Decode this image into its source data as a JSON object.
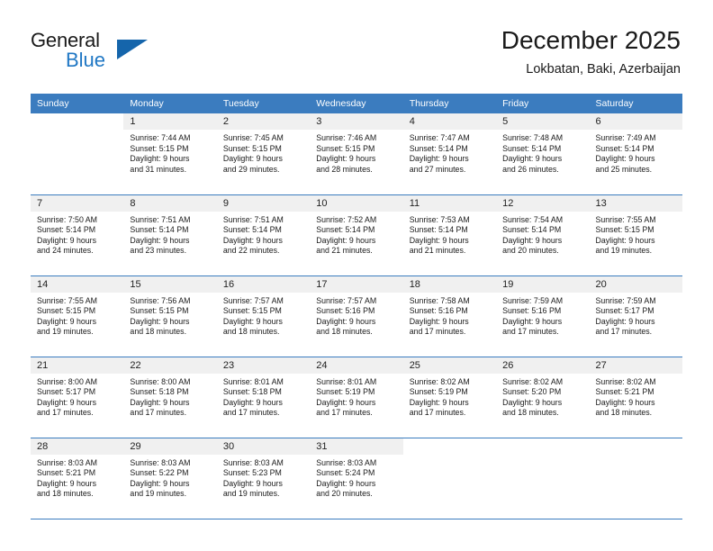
{
  "brand": {
    "line1": "General",
    "line2": "Blue",
    "triangle_color": "#1565ab",
    "blue_color": "#1f77c4"
  },
  "header": {
    "title": "December 2025",
    "subtitle": "Lokbatan, Baki, Azerbaijan"
  },
  "theme": {
    "header_bg": "#3b7cbf",
    "daynum_bg": "#f0f0f0",
    "border": "#3b7cbf"
  },
  "weekday_headers": [
    "Sunday",
    "Monday",
    "Tuesday",
    "Wednesday",
    "Thursday",
    "Friday",
    "Saturday"
  ],
  "weeks": [
    [
      {
        "day": "",
        "lines": []
      },
      {
        "day": "1",
        "lines": [
          "Sunrise: 7:44 AM",
          "Sunset: 5:15 PM",
          "Daylight: 9 hours",
          "and 31 minutes."
        ]
      },
      {
        "day": "2",
        "lines": [
          "Sunrise: 7:45 AM",
          "Sunset: 5:15 PM",
          "Daylight: 9 hours",
          "and 29 minutes."
        ]
      },
      {
        "day": "3",
        "lines": [
          "Sunrise: 7:46 AM",
          "Sunset: 5:15 PM",
          "Daylight: 9 hours",
          "and 28 minutes."
        ]
      },
      {
        "day": "4",
        "lines": [
          "Sunrise: 7:47 AM",
          "Sunset: 5:14 PM",
          "Daylight: 9 hours",
          "and 27 minutes."
        ]
      },
      {
        "day": "5",
        "lines": [
          "Sunrise: 7:48 AM",
          "Sunset: 5:14 PM",
          "Daylight: 9 hours",
          "and 26 minutes."
        ]
      },
      {
        "day": "6",
        "lines": [
          "Sunrise: 7:49 AM",
          "Sunset: 5:14 PM",
          "Daylight: 9 hours",
          "and 25 minutes."
        ]
      }
    ],
    [
      {
        "day": "7",
        "lines": [
          "Sunrise: 7:50 AM",
          "Sunset: 5:14 PM",
          "Daylight: 9 hours",
          "and 24 minutes."
        ]
      },
      {
        "day": "8",
        "lines": [
          "Sunrise: 7:51 AM",
          "Sunset: 5:14 PM",
          "Daylight: 9 hours",
          "and 23 minutes."
        ]
      },
      {
        "day": "9",
        "lines": [
          "Sunrise: 7:51 AM",
          "Sunset: 5:14 PM",
          "Daylight: 9 hours",
          "and 22 minutes."
        ]
      },
      {
        "day": "10",
        "lines": [
          "Sunrise: 7:52 AM",
          "Sunset: 5:14 PM",
          "Daylight: 9 hours",
          "and 21 minutes."
        ]
      },
      {
        "day": "11",
        "lines": [
          "Sunrise: 7:53 AM",
          "Sunset: 5:14 PM",
          "Daylight: 9 hours",
          "and 21 minutes."
        ]
      },
      {
        "day": "12",
        "lines": [
          "Sunrise: 7:54 AM",
          "Sunset: 5:14 PM",
          "Daylight: 9 hours",
          "and 20 minutes."
        ]
      },
      {
        "day": "13",
        "lines": [
          "Sunrise: 7:55 AM",
          "Sunset: 5:15 PM",
          "Daylight: 9 hours",
          "and 19 minutes."
        ]
      }
    ],
    [
      {
        "day": "14",
        "lines": [
          "Sunrise: 7:55 AM",
          "Sunset: 5:15 PM",
          "Daylight: 9 hours",
          "and 19 minutes."
        ]
      },
      {
        "day": "15",
        "lines": [
          "Sunrise: 7:56 AM",
          "Sunset: 5:15 PM",
          "Daylight: 9 hours",
          "and 18 minutes."
        ]
      },
      {
        "day": "16",
        "lines": [
          "Sunrise: 7:57 AM",
          "Sunset: 5:15 PM",
          "Daylight: 9 hours",
          "and 18 minutes."
        ]
      },
      {
        "day": "17",
        "lines": [
          "Sunrise: 7:57 AM",
          "Sunset: 5:16 PM",
          "Daylight: 9 hours",
          "and 18 minutes."
        ]
      },
      {
        "day": "18",
        "lines": [
          "Sunrise: 7:58 AM",
          "Sunset: 5:16 PM",
          "Daylight: 9 hours",
          "and 17 minutes."
        ]
      },
      {
        "day": "19",
        "lines": [
          "Sunrise: 7:59 AM",
          "Sunset: 5:16 PM",
          "Daylight: 9 hours",
          "and 17 minutes."
        ]
      },
      {
        "day": "20",
        "lines": [
          "Sunrise: 7:59 AM",
          "Sunset: 5:17 PM",
          "Daylight: 9 hours",
          "and 17 minutes."
        ]
      }
    ],
    [
      {
        "day": "21",
        "lines": [
          "Sunrise: 8:00 AM",
          "Sunset: 5:17 PM",
          "Daylight: 9 hours",
          "and 17 minutes."
        ]
      },
      {
        "day": "22",
        "lines": [
          "Sunrise: 8:00 AM",
          "Sunset: 5:18 PM",
          "Daylight: 9 hours",
          "and 17 minutes."
        ]
      },
      {
        "day": "23",
        "lines": [
          "Sunrise: 8:01 AM",
          "Sunset: 5:18 PM",
          "Daylight: 9 hours",
          "and 17 minutes."
        ]
      },
      {
        "day": "24",
        "lines": [
          "Sunrise: 8:01 AM",
          "Sunset: 5:19 PM",
          "Daylight: 9 hours",
          "and 17 minutes."
        ]
      },
      {
        "day": "25",
        "lines": [
          "Sunrise: 8:02 AM",
          "Sunset: 5:19 PM",
          "Daylight: 9 hours",
          "and 17 minutes."
        ]
      },
      {
        "day": "26",
        "lines": [
          "Sunrise: 8:02 AM",
          "Sunset: 5:20 PM",
          "Daylight: 9 hours",
          "and 18 minutes."
        ]
      },
      {
        "day": "27",
        "lines": [
          "Sunrise: 8:02 AM",
          "Sunset: 5:21 PM",
          "Daylight: 9 hours",
          "and 18 minutes."
        ]
      }
    ],
    [
      {
        "day": "28",
        "lines": [
          "Sunrise: 8:03 AM",
          "Sunset: 5:21 PM",
          "Daylight: 9 hours",
          "and 18 minutes."
        ]
      },
      {
        "day": "29",
        "lines": [
          "Sunrise: 8:03 AM",
          "Sunset: 5:22 PM",
          "Daylight: 9 hours",
          "and 19 minutes."
        ]
      },
      {
        "day": "30",
        "lines": [
          "Sunrise: 8:03 AM",
          "Sunset: 5:23 PM",
          "Daylight: 9 hours",
          "and 19 minutes."
        ]
      },
      {
        "day": "31",
        "lines": [
          "Sunrise: 8:03 AM",
          "Sunset: 5:24 PM",
          "Daylight: 9 hours",
          "and 20 minutes."
        ]
      },
      {
        "day": "",
        "lines": []
      },
      {
        "day": "",
        "lines": []
      },
      {
        "day": "",
        "lines": []
      }
    ]
  ]
}
